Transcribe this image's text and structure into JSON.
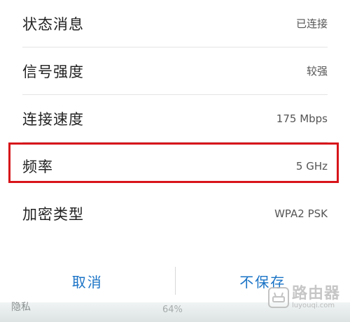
{
  "rows": [
    {
      "label": "状态消息",
      "value": "已连接"
    },
    {
      "label": "信号强度",
      "value": "较强"
    },
    {
      "label": "连接速度",
      "value": "175 Mbps"
    },
    {
      "label": "频率",
      "value": "5 GHz"
    },
    {
      "label": "加密类型",
      "value": "WPA2 PSK"
    }
  ],
  "actions": {
    "cancel_label": "取消",
    "forget_label": "不保存"
  },
  "background": {
    "left_text": "隐私",
    "mid_text": "64%"
  },
  "watermark": {
    "name": "路由器",
    "url": "luyouqi.com"
  },
  "colors": {
    "highlight": "#d7141a",
    "accent": "#1a73c6"
  }
}
